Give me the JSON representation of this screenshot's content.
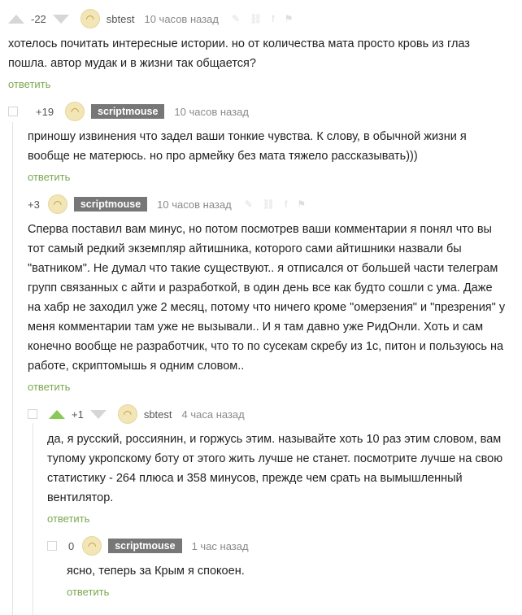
{
  "reply_label": "ответить",
  "comments": [
    {
      "rating": "-22",
      "author": "sbtest",
      "time": "10 часов назад",
      "lines": [
        "хотелось почитать интересные истории. но от количества мата просто кровь  из глаз",
        "пошла. автор мудак и в жизни так общается?"
      ]
    },
    {
      "rating": "+19",
      "author": "scriptmouse",
      "time": "10 часов назад",
      "lines": [
        "приношу извинения что задел ваши тонкие чувства. К слову, в обычной жизни я",
        "вообще не матерюсь. но про армейку без мата тяжело рассказывать)))"
      ]
    },
    {
      "rating": "+3",
      "author": "scriptmouse",
      "time": "10 часов назад",
      "lines": [
        "Сперва поставил вам минус, но потом посмотрев ваши комментарии я понял что вы",
        "тот самый редкий экземпляр айтишника, которого сами айтишники назвали бы",
        "\"ватником\". Не думал что такие существуют.. я отписался от большей части телеграм",
        "групп связанных с айти и разработкой, в один день все как будто сошли с ума. Даже",
        "на хабр не заходил уже 2 месяц, потому что ничего кроме \"омерзения\" и \"презрения\" у",
        "меня комментарии там уже не вызывали.. И я там давно уже РидОнли. Хоть и сам",
        "конечно вообще не разработчик, что то по сусекам скребу из 1с, питон и пользуюсь на",
        "работе, скриптомышь я одним словом.."
      ]
    },
    {
      "rating": "+1",
      "author": "sbtest",
      "time": "4 часа назад",
      "lines": [
        "да, я русский, россиянин, и горжусь этим. называйте хоть 10 раз этим словом, вам",
        "тупому укропскому боту от этого жить лучше не станет. посмотрите лучше на свою",
        "статистику - 264 плюса и 358 минусов, прежде чем срать на вымышленный",
        "вентилятор."
      ]
    },
    {
      "rating": "0",
      "author": "scriptmouse",
      "time": "1 час назад",
      "lines": [
        "ясно, теперь за Крым я спокоен."
      ]
    }
  ]
}
